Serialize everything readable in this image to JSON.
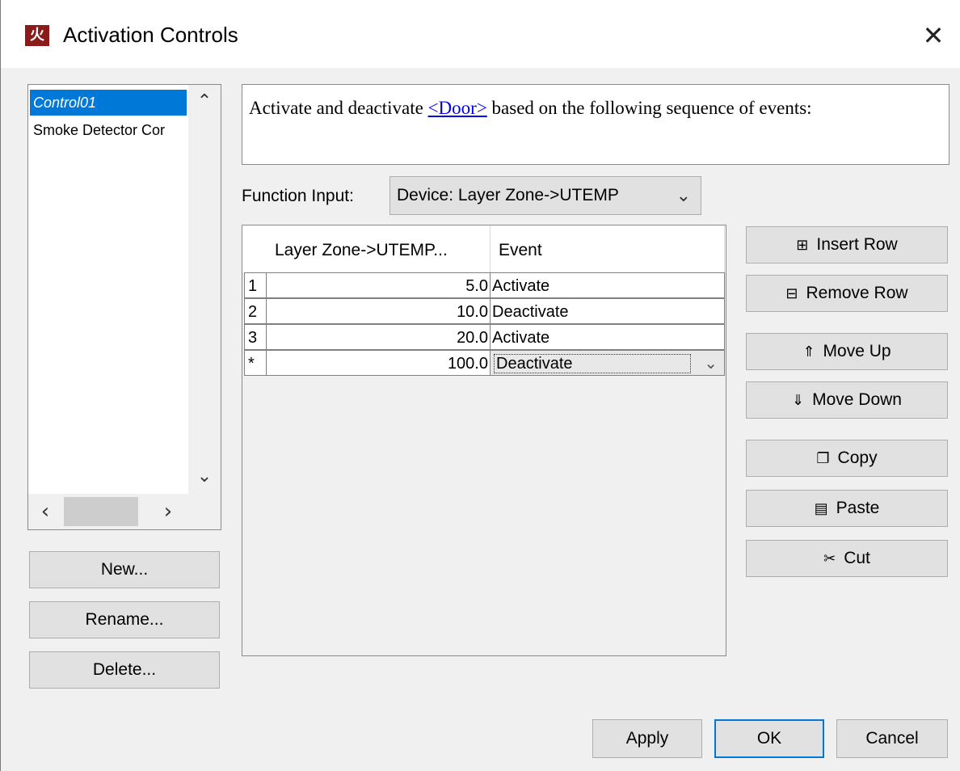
{
  "window": {
    "title": "Activation Controls",
    "icon": "app-logo-icon",
    "close_glyph": "✕"
  },
  "controls_list": {
    "items": [
      {
        "label": "Control01",
        "selected": true
      },
      {
        "label": "Smoke Detector Cor",
        "selected": false
      }
    ],
    "buttons": {
      "new": "New...",
      "rename": "Rename...",
      "delete": "Delete..."
    }
  },
  "description": {
    "before": "Activate and deactivate ",
    "link": "<Door>",
    "after": " based on the following sequence of events:"
  },
  "function_input": {
    "label": "Function Input:",
    "value": "Device: Layer Zone->UTEMP"
  },
  "table": {
    "columns": [
      "Layer Zone->UTEMP...",
      "Event"
    ],
    "rows": [
      {
        "num": "1",
        "value": "5.0",
        "event": "Activate"
      },
      {
        "num": "2",
        "value": "10.0",
        "event": "Deactivate"
      },
      {
        "num": "3",
        "value": "20.0",
        "event": "Activate"
      },
      {
        "num": "*",
        "value": "100.0",
        "event": "Deactivate"
      }
    ]
  },
  "side_buttons": {
    "insert_row": "Insert Row",
    "remove_row": "Remove Row",
    "move_up": "Move Up",
    "move_down": "Move Down",
    "copy": "Copy",
    "paste": "Paste",
    "cut": "Cut"
  },
  "dialog_buttons": {
    "apply": "Apply",
    "ok": "OK",
    "cancel": "Cancel"
  },
  "colors": {
    "selection": "#0078d7",
    "link": "#0000ee",
    "app_icon": "#8b1a1a"
  }
}
